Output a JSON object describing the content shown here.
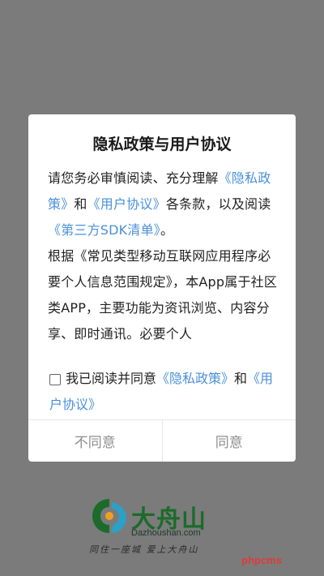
{
  "dialog": {
    "title": "隐私政策与用户协议",
    "para1": {
      "t1": "请您务必审慎阅读、充分理解",
      "link1": "《隐私政策》",
      "t2": "和",
      "link2": "《用户协议》",
      "t3": "各条款，以及阅读",
      "link3": "《第三方SDK清单》",
      "t4": "。"
    },
    "para2": "根据《常见类型移动互联网应用程序必要个人信息范围规定》，本App属于社区类APP，主要功能为资讯浏览、内容分享、即时通讯。必要个人",
    "agree": {
      "text": "我已阅读并同意",
      "link1": "《隐私政策》",
      "and": "和",
      "link2": "《用户协议》"
    },
    "buttons": {
      "disagree": "不同意",
      "agree": "同意"
    }
  },
  "background": {
    "logo_name": "大舟山",
    "logo_domain": "Dazhoushan.com",
    "logo_slogan": "同住一座城 爱上大舟山",
    "watermark": "phpcms"
  },
  "colors": {
    "overlay": "#7b7b7b",
    "link": "#4a90d9",
    "button_text": "#8f8f8f",
    "logo_green": "#1c6b2a",
    "watermark": "#e03a3a"
  }
}
